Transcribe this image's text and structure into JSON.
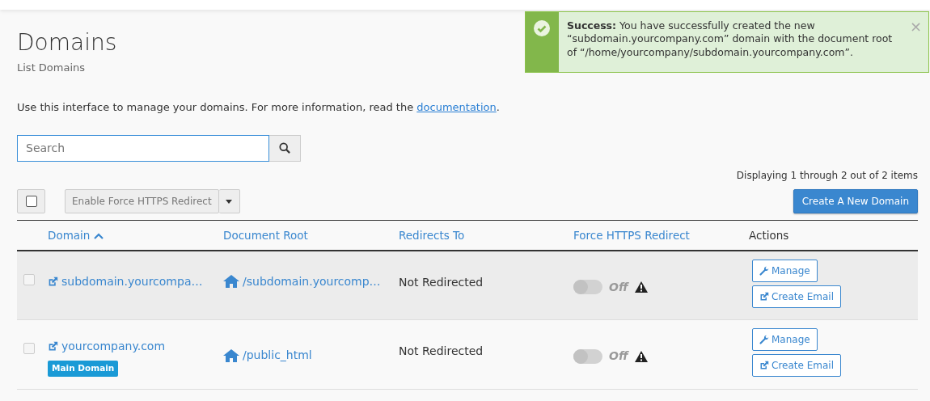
{
  "page": {
    "title": "Domains",
    "subtitle": "List Domains",
    "description": "Use this interface to manage your domains. For more information, read the ",
    "description_link": "documentation",
    "description_end": "."
  },
  "alert": {
    "message": "**Success:** You have successfully created the new “subdomain.yourcompany.com” domain with the document root of “/home/yourcompany/subdomain.yourcompany.com”.",
    "close": "×"
  },
  "search": {
    "placeholder": "Search"
  },
  "paging": "Displaying 1 through 2 out of 2 items",
  "toolbar": {
    "select_all_checked": false,
    "bulk_action": "Enable Force HTTPS Redirect",
    "create_button": "Create A New Domain"
  },
  "table": {
    "columns": [
      {
        "label": "Domain",
        "sorted": true
      },
      {
        "label": "Document Root",
        "sorted": false
      },
      {
        "label": "Redirects To",
        "sorted": false
      },
      {
        "label": "Force HTTPS Redirect",
        "sorted": false
      },
      {
        "label": "Actions",
        "sorted": false
      }
    ],
    "rows": [
      {
        "highlighted": true,
        "checked": false,
        "domain": "subdomain.yourcompa…",
        "badge": null,
        "root": "/subdomain.yourcomp…",
        "redirect": "Not Redirected",
        "https_on": false,
        "https_label": "Off",
        "actions": [
          "Manage",
          "Create Email"
        ]
      },
      {
        "highlighted": false,
        "checked": false,
        "domain": "yourcompany.com",
        "badge": "Main Domain",
        "root": "/public_html",
        "redirect": "Not Redirected",
        "https_on": false,
        "https_label": "Off",
        "actions": [
          "Manage",
          "Create Email"
        ]
      }
    ]
  }
}
